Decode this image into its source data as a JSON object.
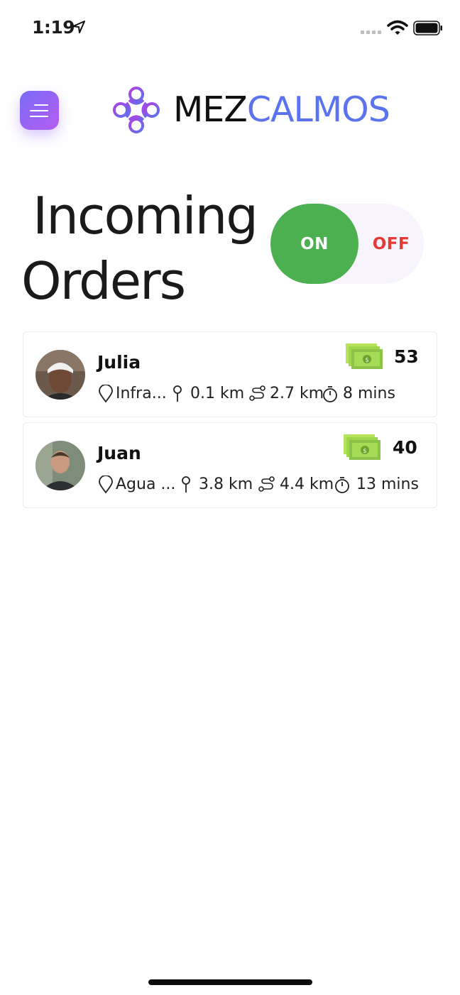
{
  "status_bar": {
    "time": "1:19",
    "location_icon": "location-arrow-icon",
    "signal_icon": "cellular-signal-icon",
    "wifi_icon": "wifi-icon",
    "battery_icon": "battery-icon"
  },
  "header": {
    "menu_icon": "hamburger-menu-icon",
    "brand_part1": "MEZ",
    "brand_part2": "CALMOS",
    "colors": {
      "brand_dark": "#111111",
      "brand_accent": "#5b74ee",
      "menu_gradient_start": "#7b6cf6",
      "menu_gradient_end": "#b45cf2"
    }
  },
  "page": {
    "title_line1": "Incoming",
    "title_line2": "Orders"
  },
  "toggle": {
    "on_label": "ON",
    "off_label": "OFF",
    "state": "on",
    "colors": {
      "on": "#4caf50",
      "off_text": "#e53935",
      "track": "#f8f4fd"
    }
  },
  "orders": [
    {
      "name": "Julia",
      "amount": "53",
      "location": "Infra...",
      "distance_to_pickup": "0.1 km",
      "route_distance": "2.7 km",
      "time": "8 mins"
    },
    {
      "name": "Juan",
      "amount": "40",
      "location": "Agua ...",
      "distance_to_pickup": "3.8 km",
      "route_distance": "4.4 km",
      "time": "13 mins"
    }
  ]
}
